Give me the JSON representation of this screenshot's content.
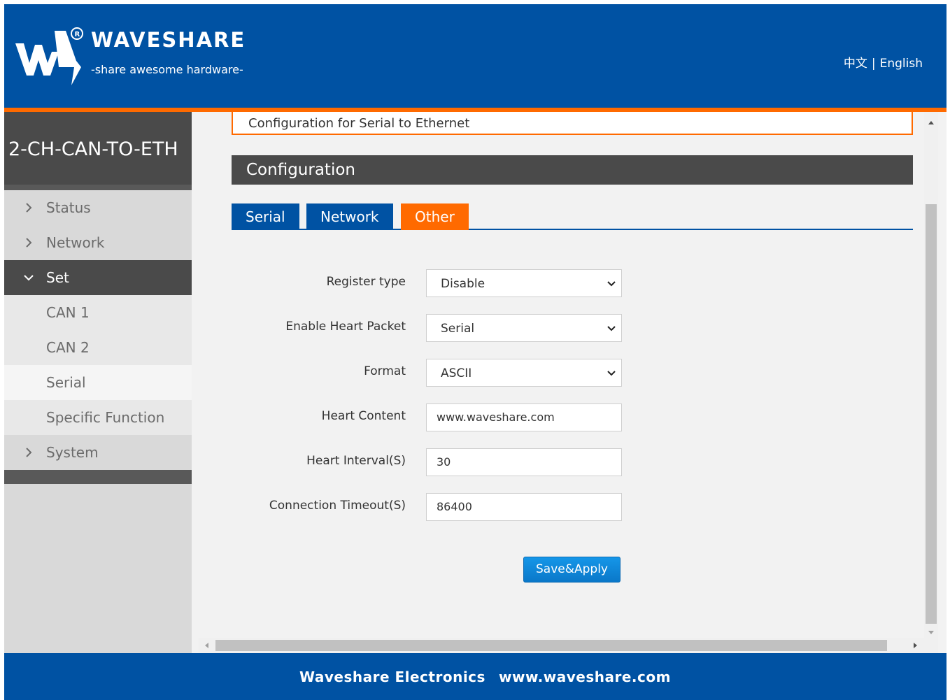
{
  "header": {
    "brand_name": "WAVESHARE",
    "tagline": "-share awesome hardware-",
    "lang_cn": "中文",
    "lang_sep": "|",
    "lang_en": "English"
  },
  "sidebar": {
    "title": "2-CH-CAN-TO-ETH",
    "items": [
      {
        "label": "Status"
      },
      {
        "label": "Network"
      },
      {
        "label": "Set"
      },
      {
        "label": "CAN 1"
      },
      {
        "label": "CAN 2"
      },
      {
        "label": "Serial"
      },
      {
        "label": "Specific Function"
      },
      {
        "label": "System"
      }
    ]
  },
  "main": {
    "prev_section_text": "Configuration for Serial to Ethernet",
    "section_title": "Configuration",
    "tabs": [
      {
        "label": "Serial"
      },
      {
        "label": "Network"
      },
      {
        "label": "Other"
      }
    ],
    "form": {
      "register_type": {
        "label": "Register type",
        "value": "Disable"
      },
      "heart_packet": {
        "label": "Enable Heart Packet",
        "value": "Serial"
      },
      "format": {
        "label": "Format",
        "value": "ASCII"
      },
      "heart_content": {
        "label": "Heart Content",
        "value": "www.waveshare.com"
      },
      "heart_interval": {
        "label": "Heart Interval(S)",
        "value": "30"
      },
      "connection_timeout": {
        "label": "Connection Timeout(S)",
        "value": "86400"
      }
    },
    "save_label": "Save&Apply"
  },
  "footer": {
    "company": "Waveshare Electronics",
    "website": "www.waveshare.com"
  },
  "colors": {
    "brand_blue": "#0052a3",
    "accent_orange": "#ff6a00",
    "dark_gray": "#4a4a4a"
  }
}
